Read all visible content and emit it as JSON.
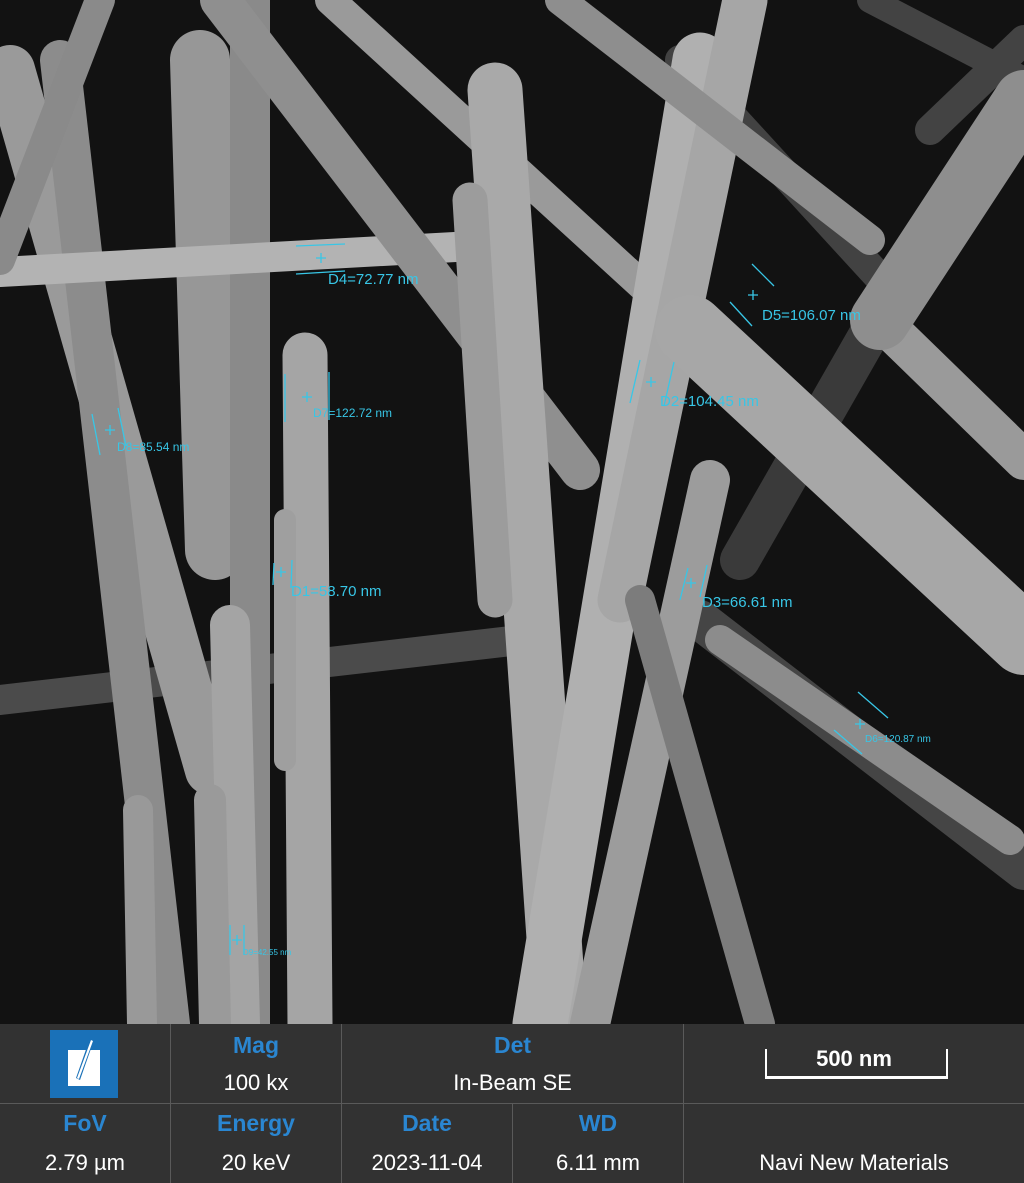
{
  "measurements": [
    {
      "id": "D1",
      "text": "D1=58.70 nm"
    },
    {
      "id": "D2",
      "text": "D2=104.45 nm"
    },
    {
      "id": "D3",
      "text": "D3=66.61 nm"
    },
    {
      "id": "D4",
      "text": "D4=72.77 nm"
    },
    {
      "id": "D5",
      "text": "D5=106.07 nm"
    },
    {
      "id": "D6",
      "text": "D6=120.87 nm"
    },
    {
      "id": "D7",
      "text": "D7=122.72 nm"
    },
    {
      "id": "D8",
      "text": "D8=85.54 nm"
    },
    {
      "id": "D9",
      "text": "D9=42.55 nm"
    }
  ],
  "info": {
    "mag_label": "Mag",
    "mag_value": "100 kx",
    "det_label": "Det",
    "det_value": "In-Beam SE",
    "scale_label": "500 nm",
    "fov_label": "FoV",
    "fov_value": "2.79 µm",
    "energy_label": "Energy",
    "energy_value": "20 keV",
    "date_label": "Date",
    "date_value": "2023-11-04",
    "wd_label": "WD",
    "wd_value": "6.11 mm",
    "org": "Navi New Materials"
  },
  "colors": {
    "accent": "#2a86d1",
    "measure": "#38c6e6",
    "panel": "#323232",
    "logo": "#1a71b8"
  },
  "logo_icon": "sem-instrument-logo-icon"
}
